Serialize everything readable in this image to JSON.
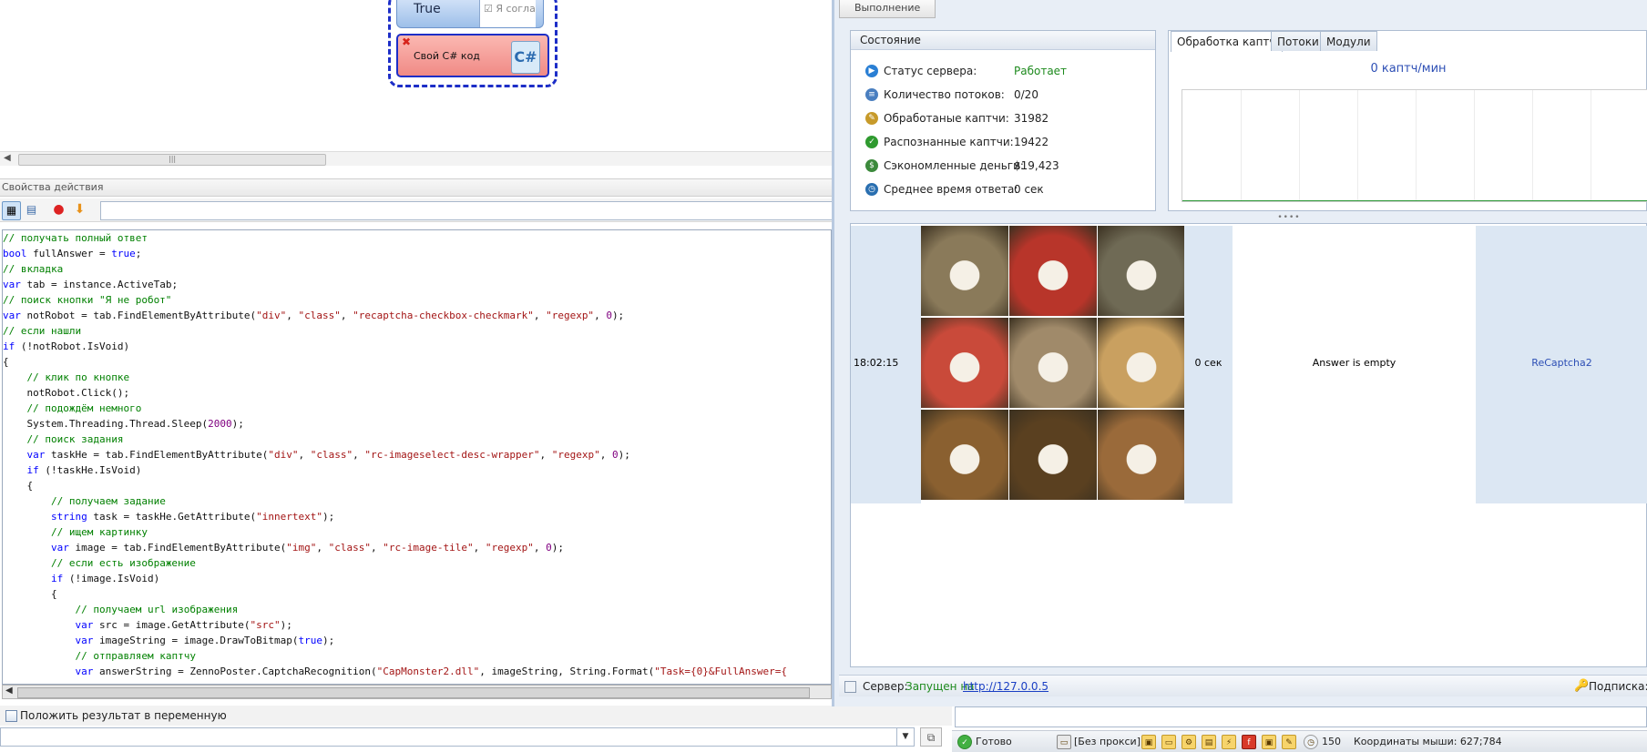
{
  "canvas": {
    "true_block": {
      "label": "True",
      "checkbox_text": "☑ Я согласе"
    },
    "csharp_block": {
      "label": "Свой C# код",
      "icon": "C#"
    }
  },
  "props": {
    "title": "Свойства действия"
  },
  "code_lines": [
    [
      {
        "c": "cm",
        "t": "// получать полный ответ"
      }
    ],
    [
      {
        "c": "kw",
        "t": "bool"
      },
      {
        "c": "tx",
        "t": " fullAnswer = "
      },
      {
        "c": "kw",
        "t": "true"
      },
      {
        "c": "tx",
        "t": ";"
      }
    ],
    [
      {
        "c": "cm",
        "t": "// вкладка"
      }
    ],
    [
      {
        "c": "kw",
        "t": "var"
      },
      {
        "c": "tx",
        "t": " tab = instance.ActiveTab;"
      }
    ],
    [
      {
        "c": "cm",
        "t": "// поиск кнопки \"Я не робот\""
      }
    ],
    [
      {
        "c": "kw",
        "t": "var"
      },
      {
        "c": "tx",
        "t": " notRobot = tab.FindElementByAttribute("
      },
      {
        "c": "st",
        "t": "\"div\""
      },
      {
        "c": "tx",
        "t": ", "
      },
      {
        "c": "st",
        "t": "\"class\""
      },
      {
        "c": "tx",
        "t": ", "
      },
      {
        "c": "st",
        "t": "\"recaptcha-checkbox-checkmark\""
      },
      {
        "c": "tx",
        "t": ", "
      },
      {
        "c": "st",
        "t": "\"regexp\""
      },
      {
        "c": "tx",
        "t": ", "
      },
      {
        "c": "nm",
        "t": "0"
      },
      {
        "c": "tx",
        "t": ");"
      }
    ],
    [
      {
        "c": "cm",
        "t": "// если нашли"
      }
    ],
    [
      {
        "c": "kw",
        "t": "if"
      },
      {
        "c": "tx",
        "t": " (!notRobot.IsVoid)"
      }
    ],
    [
      {
        "c": "tx",
        "t": "{"
      }
    ],
    [
      {
        "c": "tx",
        "t": "    "
      },
      {
        "c": "cm",
        "t": "// клик по кнопке"
      }
    ],
    [
      {
        "c": "tx",
        "t": "    notRobot.Click();"
      }
    ],
    [
      {
        "c": "tx",
        "t": "    "
      },
      {
        "c": "cm",
        "t": "// подождём немного"
      }
    ],
    [
      {
        "c": "tx",
        "t": "    System.Threading.Thread.Sleep("
      },
      {
        "c": "nm",
        "t": "2000"
      },
      {
        "c": "tx",
        "t": ");"
      }
    ],
    [
      {
        "c": "tx",
        "t": "    "
      },
      {
        "c": "cm",
        "t": "// поиск задания"
      }
    ],
    [
      {
        "c": "tx",
        "t": "    "
      },
      {
        "c": "kw",
        "t": "var"
      },
      {
        "c": "tx",
        "t": " taskHe = tab.FindElementByAttribute("
      },
      {
        "c": "st",
        "t": "\"div\""
      },
      {
        "c": "tx",
        "t": ", "
      },
      {
        "c": "st",
        "t": "\"class\""
      },
      {
        "c": "tx",
        "t": ", "
      },
      {
        "c": "st",
        "t": "\"rc-imageselect-desc-wrapper\""
      },
      {
        "c": "tx",
        "t": ", "
      },
      {
        "c": "st",
        "t": "\"regexp\""
      },
      {
        "c": "tx",
        "t": ", "
      },
      {
        "c": "nm",
        "t": "0"
      },
      {
        "c": "tx",
        "t": ");"
      }
    ],
    [
      {
        "c": "tx",
        "t": "    "
      },
      {
        "c": "kw",
        "t": "if"
      },
      {
        "c": "tx",
        "t": " (!taskHe.IsVoid)"
      }
    ],
    [
      {
        "c": "tx",
        "t": "    {"
      }
    ],
    [
      {
        "c": "tx",
        "t": "        "
      },
      {
        "c": "cm",
        "t": "// получаем задание"
      }
    ],
    [
      {
        "c": "tx",
        "t": "        "
      },
      {
        "c": "kw",
        "t": "string"
      },
      {
        "c": "tx",
        "t": " task = taskHe.GetAttribute("
      },
      {
        "c": "st",
        "t": "\"innertext\""
      },
      {
        "c": "tx",
        "t": ");"
      }
    ],
    [
      {
        "c": "tx",
        "t": "        "
      },
      {
        "c": "cm",
        "t": "// ищем картинку"
      }
    ],
    [
      {
        "c": "tx",
        "t": "        "
      },
      {
        "c": "kw",
        "t": "var"
      },
      {
        "c": "tx",
        "t": " image = tab.FindElementByAttribute("
      },
      {
        "c": "st",
        "t": "\"img\""
      },
      {
        "c": "tx",
        "t": ", "
      },
      {
        "c": "st",
        "t": "\"class\""
      },
      {
        "c": "tx",
        "t": ", "
      },
      {
        "c": "st",
        "t": "\"rc-image-tile\""
      },
      {
        "c": "tx",
        "t": ", "
      },
      {
        "c": "st",
        "t": "\"regexp\""
      },
      {
        "c": "tx",
        "t": ", "
      },
      {
        "c": "nm",
        "t": "0"
      },
      {
        "c": "tx",
        "t": ");"
      }
    ],
    [
      {
        "c": "tx",
        "t": "        "
      },
      {
        "c": "cm",
        "t": "// если есть изображение"
      }
    ],
    [
      {
        "c": "tx",
        "t": "        "
      },
      {
        "c": "kw",
        "t": "if"
      },
      {
        "c": "tx",
        "t": " (!image.IsVoid)"
      }
    ],
    [
      {
        "c": "tx",
        "t": "        {"
      }
    ],
    [
      {
        "c": "tx",
        "t": "            "
      },
      {
        "c": "cm",
        "t": "// получаем url изображения"
      }
    ],
    [
      {
        "c": "tx",
        "t": "            "
      },
      {
        "c": "kw",
        "t": "var"
      },
      {
        "c": "tx",
        "t": " src = image.GetAttribute("
      },
      {
        "c": "st",
        "t": "\"src\""
      },
      {
        "c": "tx",
        "t": ");"
      }
    ],
    [
      {
        "c": "tx",
        "t": "            "
      },
      {
        "c": "kw",
        "t": "var"
      },
      {
        "c": "tx",
        "t": " imageString = image.DrawToBitmap("
      },
      {
        "c": "kw",
        "t": "true"
      },
      {
        "c": "tx",
        "t": ");"
      }
    ],
    [
      {
        "c": "tx",
        "t": "            "
      },
      {
        "c": "cm",
        "t": "// отправляем каптчу"
      }
    ],
    [
      {
        "c": "tx",
        "t": "            "
      },
      {
        "c": "kw",
        "t": "var"
      },
      {
        "c": "tx",
        "t": " answerString = ZennoPoster.CaptchaRecognition("
      },
      {
        "c": "st",
        "t": "\"CapMonster2.dll\""
      },
      {
        "c": "tx",
        "t": ", imageString, String.Format("
      },
      {
        "c": "st",
        "t": "\"Task={0}&FullAnswer={"
      }
    ]
  ],
  "put_result_label": "Положить результат в переменную",
  "exec_tab": "Выполнение",
  "state": {
    "title": "Состояние",
    "rows": [
      {
        "icon": "play-icon",
        "color": "#2a7fd4",
        "label": "Статус сервера:",
        "value": "Работает",
        "value_color": "#1d8a1d"
      },
      {
        "icon": "threads-icon",
        "color": "#4a7fc0",
        "label": "Количество потоков:",
        "value": "0/20",
        "value_color": "#222"
      },
      {
        "icon": "edit-icon",
        "color": "#c79a2a",
        "label": "Обработаные каптчи:",
        "value": "31982",
        "value_color": "#222"
      },
      {
        "icon": "check-icon",
        "color": "#2f9a2f",
        "label": "Распознанные каптчи:",
        "value": "19422",
        "value_color": "#222"
      },
      {
        "icon": "money-icon",
        "color": "#3c8a3c",
        "label": "Сэкономленные деньги:",
        "value": "$19,423",
        "value_color": "#222"
      },
      {
        "icon": "clock-icon",
        "color": "#2a6fb0",
        "label": "Среднее время ответа:",
        "value": "0 сек",
        "value_color": "#222"
      }
    ]
  },
  "captcha": {
    "tabs": [
      "Обработка каптч",
      "Потоки",
      "Модули"
    ],
    "rate": "0 каптч/мин"
  },
  "entry": {
    "time": "18:02:15",
    "seconds": "0 сек",
    "answer": "Answer is empty",
    "type": "ReCaptcha2",
    "tiles": [
      "#8a7a5a",
      "#b8352a",
      "#6f6a55",
      "#c94a3a",
      "#a08a6a",
      "#c9a060",
      "#8a6030",
      "#5a4020",
      "#9a6a3a"
    ]
  },
  "server": {
    "label": "Сервер:",
    "status": "Запущен на",
    "url": "http://127.0.0.5",
    "subscription": "Подписка:"
  },
  "statusbar": {
    "ready": "Готово",
    "proxy": "[Без прокси]",
    "count": "150",
    "coords": "Координаты мыши: 627;784"
  }
}
